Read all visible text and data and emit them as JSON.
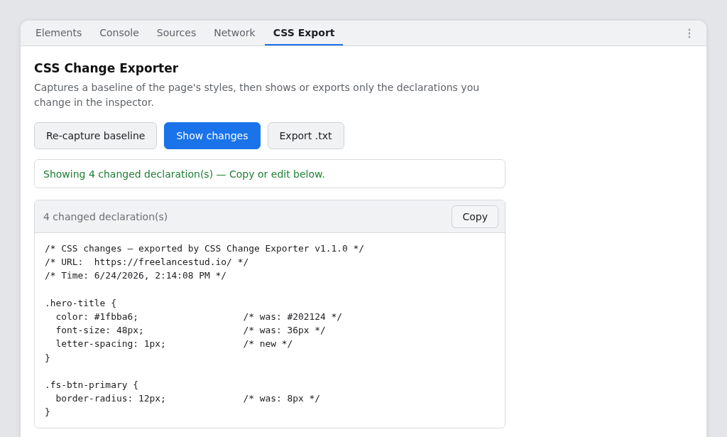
{
  "tabs": [
    {
      "label": "Elements",
      "selected": false
    },
    {
      "label": "Console",
      "selected": false
    },
    {
      "label": "Sources",
      "selected": false
    },
    {
      "label": "Network",
      "selected": false
    },
    {
      "label": "CSS Export",
      "selected": true
    }
  ],
  "panel": {
    "title": "CSS Change Exporter",
    "description": "Captures a baseline of the page's styles, then shows or exports only the declarations you change in the inspector.",
    "buttons": [
      {
        "label": "Re-capture baseline",
        "kind": "secondary"
      },
      {
        "label": "Show changes",
        "kind": "primary"
      },
      {
        "label": "Export .txt",
        "kind": "secondary"
      }
    ],
    "status": {
      "text": "Showing 4 changed declaration(s) — Copy or edit below.",
      "kind": "success"
    },
    "output": {
      "header": "4 changed declaration(s)",
      "copy_button": "Copy",
      "code": "/* CSS changes — exported by CSS Change Exporter v1.1.0 */\n/* URL:  https://freelancestud.io/ */\n/* Time: 6/24/2026, 2:14:08 PM */\n\n.hero-title {\n  color: #1fbba6;                   /* was: #202124 */\n  font-size: 48px;                  /* was: 36px */\n  letter-spacing: 1px;              /* new */\n}\n\n.fs-btn-primary {\n  border-radius: 12px;              /* was: 8px */\n}"
    }
  }
}
